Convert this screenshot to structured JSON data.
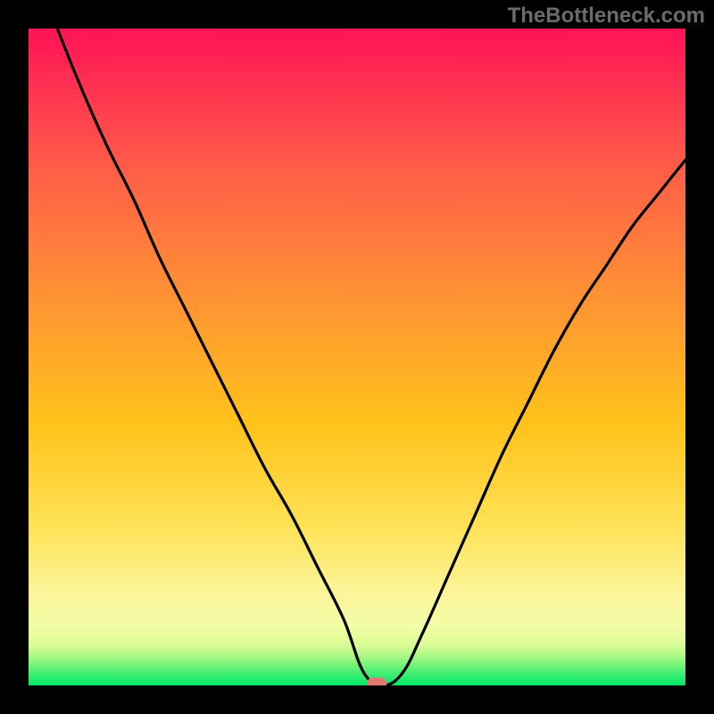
{
  "watermark": "TheBottleneck.com",
  "marker": {
    "x_pct": 53,
    "y_pct": 0
  },
  "chart_data": {
    "type": "line",
    "title": "",
    "xlabel": "",
    "ylabel": "",
    "xlim_pct": [
      0,
      100
    ],
    "ylim_pct": [
      0,
      100
    ],
    "series": [
      {
        "name": "bottleneck-curve",
        "x_pct": [
          0,
          4,
          8,
          12,
          16,
          20,
          24,
          28,
          32,
          36,
          40,
          44,
          48,
          51,
          54,
          57,
          60,
          64,
          68,
          72,
          76,
          80,
          84,
          88,
          92,
          96,
          100
        ],
        "y_pct": [
          112,
          101,
          91,
          82,
          74,
          65,
          57,
          49,
          41,
          33,
          26,
          18,
          10,
          2,
          0,
          2,
          8,
          17,
          26,
          35,
          43,
          51,
          58,
          64,
          70,
          75,
          80
        ]
      }
    ],
    "gradient_stops": [
      {
        "offset": 0,
        "color": "#00e86b"
      },
      {
        "offset": 2,
        "color": "#47ef74"
      },
      {
        "offset": 4,
        "color": "#9af77f"
      },
      {
        "offset": 6,
        "color": "#d8fb94"
      },
      {
        "offset": 9,
        "color": "#f3fca6"
      },
      {
        "offset": 14,
        "color": "#fbf59a"
      },
      {
        "offset": 24,
        "color": "#ffe257"
      },
      {
        "offset": 40,
        "color": "#ffc21a"
      },
      {
        "offset": 58,
        "color": "#ff9533"
      },
      {
        "offset": 78,
        "color": "#ff5f47"
      },
      {
        "offset": 92,
        "color": "#ff2f52"
      },
      {
        "offset": 100,
        "color": "#ff1356"
      }
    ]
  }
}
